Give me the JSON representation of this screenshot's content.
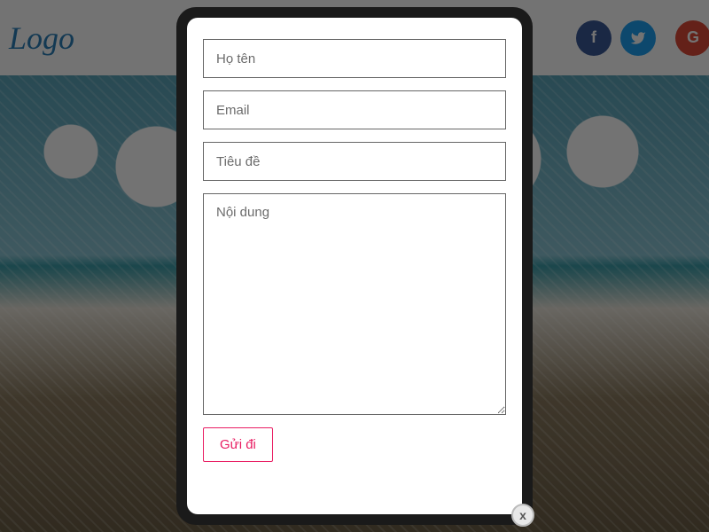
{
  "header": {
    "logo": "Logo"
  },
  "socials": {
    "facebook": "f",
    "twitter": "🐦",
    "google": "G"
  },
  "form": {
    "name_placeholder": "Họ tên",
    "email_placeholder": "Email",
    "subject_placeholder": "Tiêu đề",
    "content_placeholder": "Nội dung",
    "submit_label": "Gửi đi"
  },
  "close_label": "x"
}
